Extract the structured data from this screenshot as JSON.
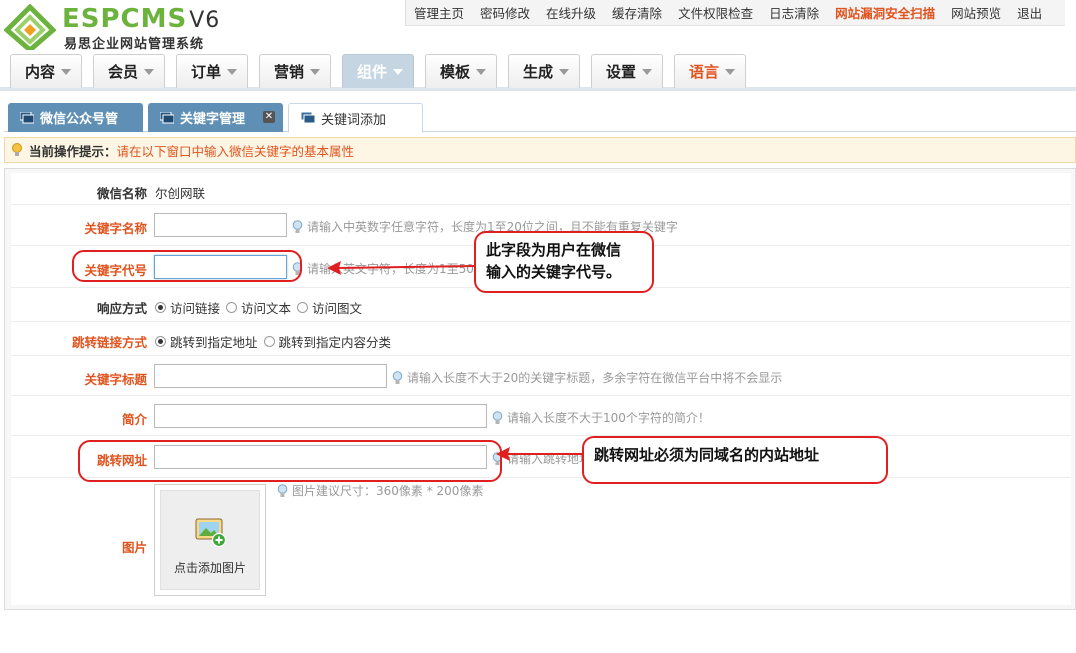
{
  "brand": {
    "name": "ESPCMS",
    "version": "V6",
    "subtitle": "易思企业网站管理系统",
    "accent": "#6cb33e"
  },
  "top_links": [
    {
      "label": "管理主页",
      "icon": "",
      "highlight": false
    },
    {
      "label": "密码修改",
      "highlight": false
    },
    {
      "label": "在线升级",
      "highlight": false
    },
    {
      "label": "缓存清除",
      "highlight": false
    },
    {
      "label": "文件权限检查",
      "highlight": false
    },
    {
      "label": "日志清除",
      "highlight": false
    },
    {
      "label": "网站漏洞安全扫描",
      "highlight": true
    },
    {
      "label": "网站预览",
      "highlight": false
    },
    {
      "label": "退出",
      "highlight": false
    }
  ],
  "main_nav": [
    {
      "label": "内容"
    },
    {
      "label": "会员"
    },
    {
      "label": "订单"
    },
    {
      "label": "营销"
    },
    {
      "label": "组件",
      "active": true
    },
    {
      "label": "模板"
    },
    {
      "label": "生成"
    },
    {
      "label": "设置"
    },
    {
      "label": "语言"
    }
  ],
  "sub_tabs": [
    {
      "label": "微信公众号管",
      "closable": false,
      "active": false
    },
    {
      "label": "关键字管理",
      "closable": true,
      "active": false
    },
    {
      "label": "关键词添加",
      "closable": false,
      "active": true
    }
  ],
  "hint": {
    "label": "当前操作提示：",
    "text": "请在以下窗口中输入微信关键字的基本属性"
  },
  "form": {
    "wechat_name": {
      "label": "微信名称",
      "value": "尔创网联"
    },
    "keyword_name": {
      "label": "关键字名称",
      "value": "",
      "tip": "请输入中英数字任意字符，长度为1至20位之间，且不能有重复关键字"
    },
    "keyword_code": {
      "label": "关键字代号",
      "value": "",
      "tip": "请输入英文字符，长度为1至50"
    },
    "response_mode": {
      "label": "响应方式",
      "options": [
        "访问链接",
        "访问文本",
        "访问图文"
      ],
      "selected": 0
    },
    "link_mode": {
      "label": "跳转链接方式",
      "options": [
        "跳转到指定地址",
        "跳转到指定内容分类"
      ],
      "selected": 0
    },
    "keyword_title": {
      "label": "关键字标题",
      "value": "",
      "tip": "请输入长度不大于20的关键字标题，多余字符在微信平台中将不会显示"
    },
    "intro": {
      "label": "简介",
      "value": "",
      "tip": "请输入长度不大于100个字符的简介！"
    },
    "jump_url": {
      "label": "跳转网址",
      "value": "",
      "tip": "请输入跳转地址"
    },
    "image": {
      "label": "图片",
      "tip": "图片建议尺寸：360像素 * 200像素",
      "upload_label": "点击添加图片"
    }
  },
  "annotations": {
    "callout_code": "此字段为用户在微信输入的关键字代号。",
    "callout_code_line1": "此字段为用户在微信",
    "callout_code_line2": "输入的关键字代号。",
    "callout_url": "跳转网址必须为同域名的内站地址",
    "color": "#e02020"
  }
}
